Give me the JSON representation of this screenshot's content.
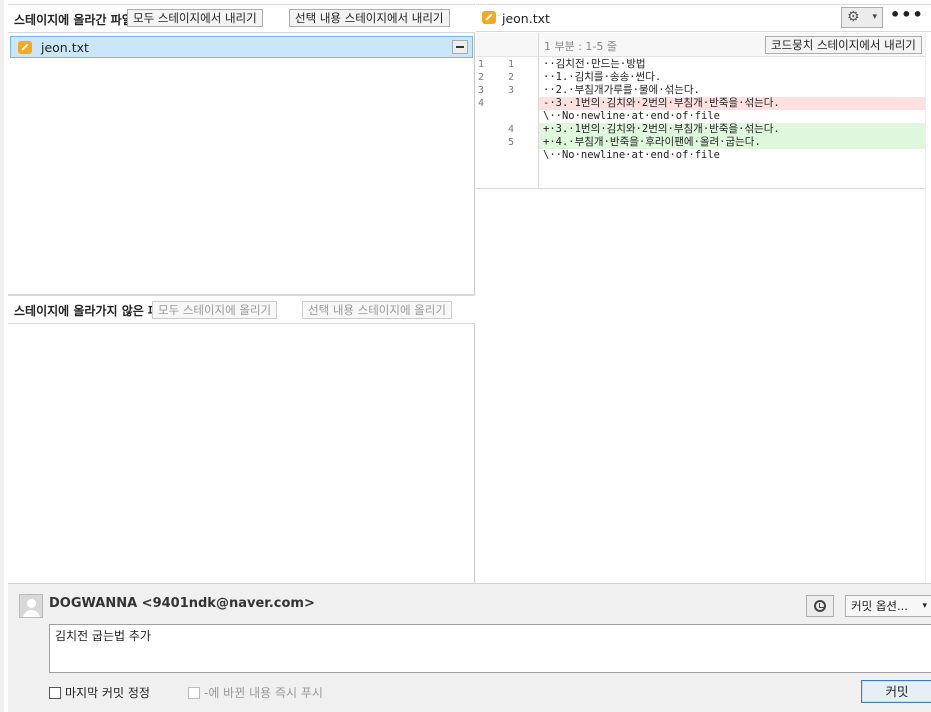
{
  "staged": {
    "title": "스테이지에 올라간 파일",
    "unstage_all_label": "모두 스테이지에서 내리기",
    "unstage_selected_label": "선택 내용 스테이지에서 내리기",
    "files": [
      {
        "name": "jeon.txt",
        "status_icon": "pencil-modified-icon"
      }
    ]
  },
  "unstaged": {
    "title": "스테이지에 올라가지 않은 파일",
    "stage_all_label": "모두 스테이지에 올리기",
    "stage_selected_label": "선택 내용 스테이지에 올리기"
  },
  "diff": {
    "file_name": "jeon.txt",
    "hunk_label": "1 부분 : 1-5 줄",
    "hunk_unstage_label": "코드뭉치 스테이지에서 내리기",
    "lines": [
      {
        "old": "1",
        "new": "1",
        "type": "ctx",
        "text": "··김치전·만드는·방법"
      },
      {
        "old": "2",
        "new": "2",
        "type": "ctx",
        "text": "··1.·김치를·송송·썬다."
      },
      {
        "old": "3",
        "new": "3",
        "type": "ctx",
        "text": "··2.·부침개가루를·물에·섞는다."
      },
      {
        "old": "4",
        "new": "",
        "type": "del",
        "text": "-·3.·1번의·김치와·2번의·부침개·반죽을·섞는다."
      },
      {
        "old": "",
        "new": "",
        "type": "ctx",
        "text": "\\··No·newline·at·end·of·file"
      },
      {
        "old": "",
        "new": "4",
        "type": "add",
        "text": "+·3.·1번의·김치와·2번의·부침개·반죽을·섞는다."
      },
      {
        "old": "",
        "new": "5",
        "type": "add",
        "text": "+·4.·부침개·반죽을·후라이팬에·올려·굽는다."
      },
      {
        "old": "",
        "new": "",
        "type": "ctx",
        "text": "\\··No·newline·at·end·of·file"
      }
    ]
  },
  "commit": {
    "author": "DOGWANNA <9401ndk@naver.com>",
    "options_label": "커밋 옵션...",
    "message": "김치전 굽는법 추가",
    "amend_label": "마지막 커밋 정정",
    "push_label": "-에 바뀐 내용 즉시 푸시",
    "commit_label": "커밋"
  }
}
